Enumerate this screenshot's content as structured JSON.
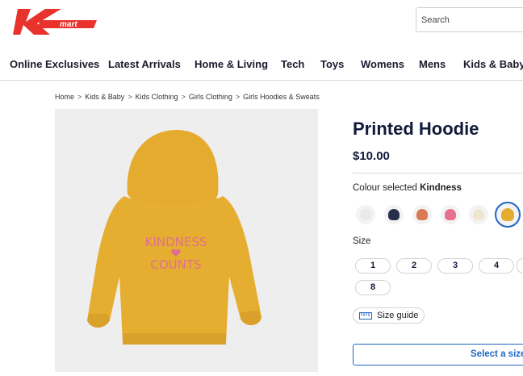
{
  "header": {
    "logo_text": "Kmart",
    "search": {
      "placeholder": "Search",
      "value": ""
    },
    "brand_red": "#e8322b"
  },
  "nav": {
    "items": [
      {
        "label": "Online Exclusives"
      },
      {
        "label": "Latest Arrivals"
      },
      {
        "label": "Home & Living"
      },
      {
        "label": "Tech"
      },
      {
        "label": "Toys"
      },
      {
        "label": "Womens"
      },
      {
        "label": "Mens"
      },
      {
        "label": "Kids & Baby"
      }
    ]
  },
  "breadcrumb": {
    "items": [
      "Home",
      "Kids & Baby",
      "Kids Clothing",
      "Girls Clothing",
      "Girls Hoodies & Sweats"
    ],
    "separator": ">"
  },
  "product": {
    "title": "Printed Hoodie",
    "price": "$10.00",
    "image_print_line1": "KINDNESS",
    "image_print_line2": "COUNTS",
    "colour_label": "Colour selected",
    "colour_selected": "Kindness",
    "colours": [
      {
        "icon": "white-hoodie-swatch",
        "color": "#e9e9e9"
      },
      {
        "icon": "navy-hoodie-swatch",
        "color": "#27304a"
      },
      {
        "icon": "rust-hoodie-swatch",
        "color": "#d97a52"
      },
      {
        "icon": "pink-hoodie-swatch",
        "color": "#e7708f"
      },
      {
        "icon": "cream-hoodie-swatch",
        "color": "#efe6cf"
      },
      {
        "icon": "mustard-hoodie-swatch",
        "color": "#e4ad2f",
        "selected": true
      }
    ],
    "size_label": "Size",
    "sizes": [
      "1",
      "2",
      "3",
      "4",
      "8"
    ],
    "size_guide_label": "Size guide",
    "select_size_label": "Select a size",
    "accent_color": "#1f66c1"
  }
}
